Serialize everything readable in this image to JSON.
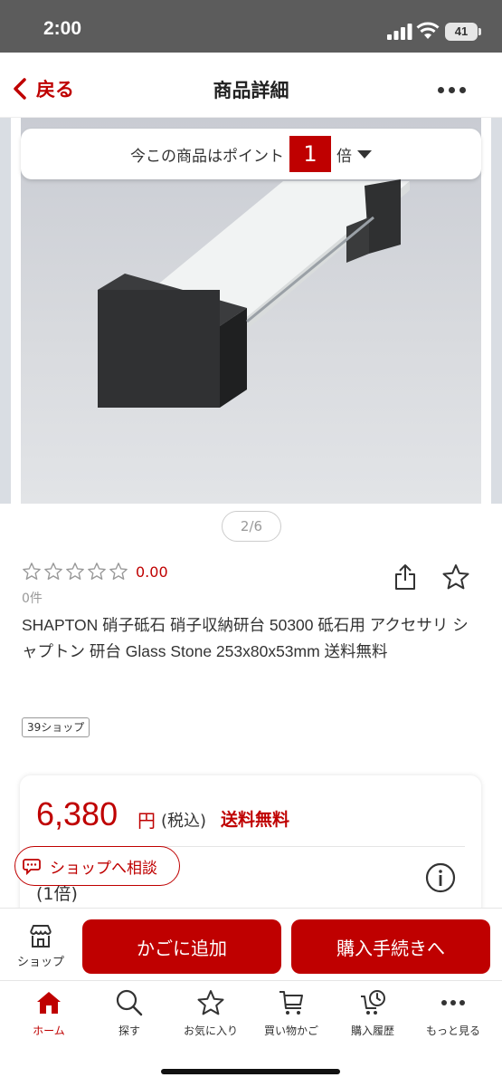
{
  "status_bar": {
    "time": "2:00",
    "battery": "41"
  },
  "nav": {
    "back_label": "戻る",
    "title": "商品詳細"
  },
  "points_banner": {
    "prefix": "今この商品はポイント",
    "multiplier": "1",
    "suffix": "倍"
  },
  "gallery": {
    "pager": "2/6"
  },
  "rating": {
    "score": "0.00",
    "review_count": "0件",
    "stars_filled": 0,
    "stars_total": 5
  },
  "product": {
    "title": "SHAPTON 硝子砥石 硝子収納研台 50300 砥石用 アクセサリ シャプトン 研台 Glass Stone 253x80x53mm 送料無料",
    "shop_tag": "39ショップ"
  },
  "price": {
    "amount": "6,380",
    "unit": "円",
    "tax": "(税込)",
    "shipping": "送料無料",
    "points_multiplier": "(1倍)"
  },
  "consult_button": {
    "label": "ショップへ相談"
  },
  "action_bar": {
    "shop_label": "ショップ",
    "cart_label": "かごに追加",
    "buy_label": "購入手続きへ"
  },
  "tabs": [
    {
      "label": "ホーム",
      "icon": "home-icon",
      "active": true
    },
    {
      "label": "探す",
      "icon": "search-icon",
      "active": false
    },
    {
      "label": "お気に入り",
      "icon": "star-icon",
      "active": false
    },
    {
      "label": "買い物かご",
      "icon": "cart-icon",
      "active": false
    },
    {
      "label": "購入履歴",
      "icon": "history-icon",
      "active": false
    },
    {
      "label": "もっと見る",
      "icon": "more-icon",
      "active": false
    }
  ],
  "colors": {
    "brand": "#bf0000",
    "text": "#333333",
    "muted": "#999999"
  }
}
